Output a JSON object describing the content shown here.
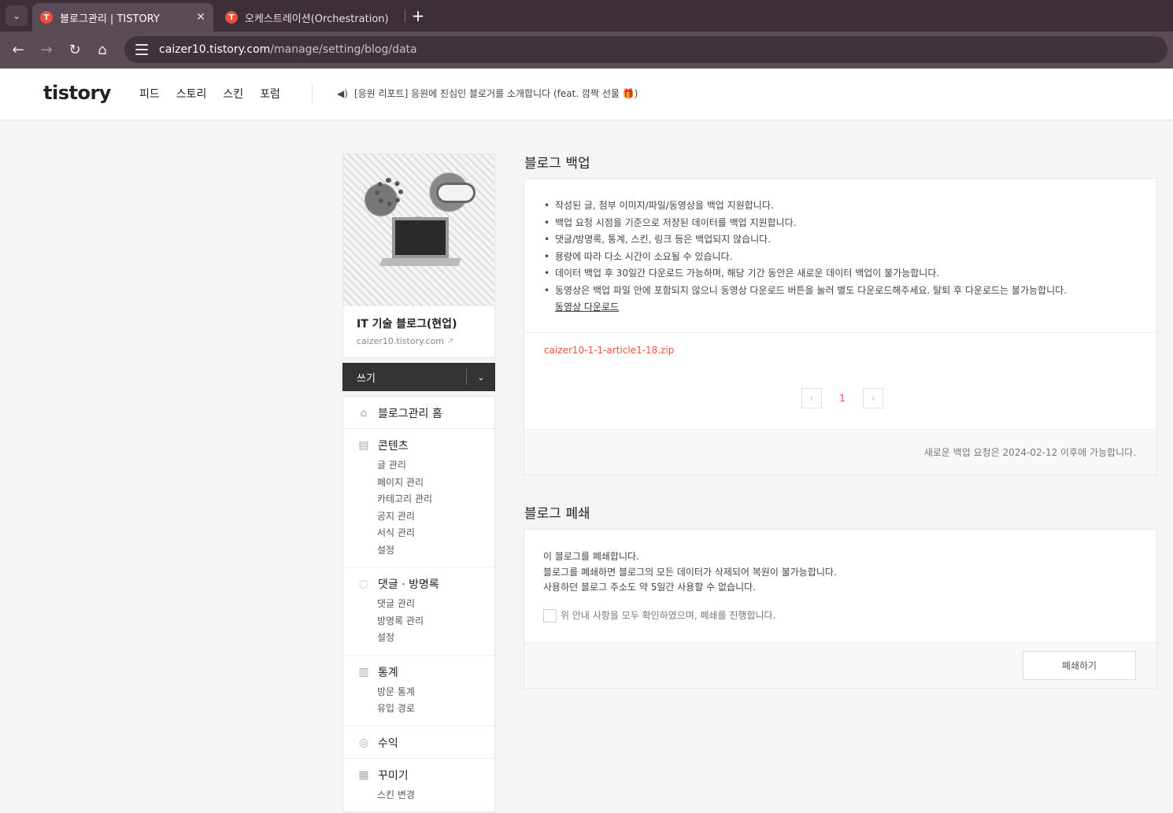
{
  "browser": {
    "tabs": [
      {
        "title": "블로그관리 | TISTORY",
        "active": true
      },
      {
        "title": "오케스트레이션(Orchestration)",
        "active": false
      }
    ],
    "url_domain": "caizer10.tistory.com",
    "url_path": "/manage/setting/blog/data"
  },
  "header": {
    "logo": "tistory",
    "nav": [
      "피드",
      "스토리",
      "스킨",
      "포럼"
    ],
    "notice": "[응원 리포트] 응원에 진심인 블로거를 소개합니다 (feat. 깜짝 선물 🎁)"
  },
  "sidebar": {
    "blog_title": "IT 기술 블로그(현업)",
    "blog_url": "caizer10.tistory.com",
    "write_label": "쓰기",
    "home_label": "블로그관리 홈",
    "groups": [
      {
        "title": "콘텐츠",
        "icon": "document-icon",
        "items": [
          "글 관리",
          "페이지 관리",
          "카테고리 관리",
          "공지 관리",
          "서식 관리",
          "설정"
        ]
      },
      {
        "title": "댓글 · 방명록",
        "icon": "speech-bubble-icon",
        "items": [
          "댓글 관리",
          "방명록 관리",
          "설정"
        ]
      },
      {
        "title": "통계",
        "icon": "bar-chart-icon",
        "items": [
          "방문 통계",
          "유입 경로"
        ]
      },
      {
        "title": "수익",
        "icon": "coin-icon",
        "items": []
      },
      {
        "title": "꾸미기",
        "icon": "layout-icon",
        "items": [
          "스킨 변경"
        ]
      }
    ]
  },
  "backup": {
    "title": "블로그 백업",
    "bullets": [
      "작성된 글, 첨부 이미지/파일/동영상을 백업 지원합니다.",
      "백업 요청 시점을 기준으로 저장된 데이터를 백업 지원합니다.",
      "댓글/방명록, 통계, 스킨, 링크 등은 백업되지 않습니다.",
      "용량에 따라 다소 시간이 소요될 수 있습니다.",
      "데이터 백업 후 30일간 다운로드 가능하며, 해당 기간 동안은 새로운 데이터 백업이 불가능합니다.",
      "동영상은 백업 파일 안에 포함되지 않으니 동영상 다운로드 버튼을 눌러 별도 다운로드해주세요. 탈퇴 후 다운로드는 불가능합니다."
    ],
    "video_link": "동영상 다운로드",
    "zip_file": "caizer10-1-1-article1-18.zip",
    "page": "1",
    "footer_note": "새로운 백업 요청은 2024-02-12 이후에 가능합니다."
  },
  "close": {
    "title": "블로그 폐쇄",
    "lines": [
      "이 블로그를 폐쇄합니다.",
      "블로그를 폐쇄하면 블로그의 모든 데이터가 삭제되어 복원이 불가능합니다.",
      "사용하던 블로그 주소도 약 5일간 사용할 수 없습니다."
    ],
    "agree_label": "위 안내 사항을 모두 확인하였으며, 폐쇄를 진행합니다.",
    "button": "폐쇄하기"
  }
}
